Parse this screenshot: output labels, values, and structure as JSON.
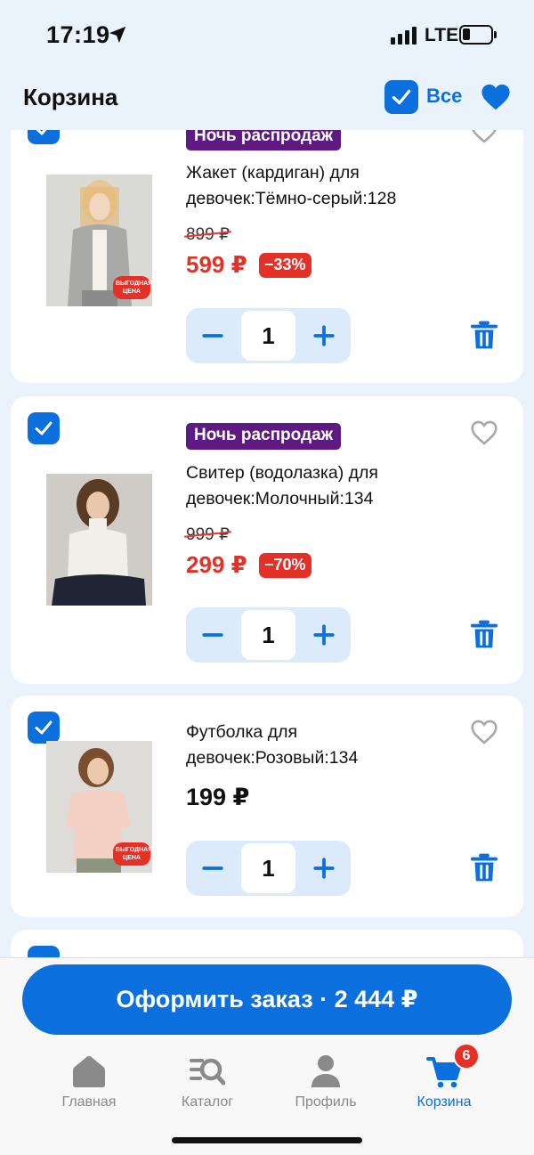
{
  "status_bar": {
    "time": "17:19",
    "network": "LTE"
  },
  "header": {
    "title": "Корзина",
    "select_all_label": "Все"
  },
  "cart_items": [
    {
      "promo": "Ночь распродаж",
      "title": "Жакет (кардиган) для девочек:Тёмно-серый:128",
      "old_price": "899 ₽",
      "price": "599 ₽",
      "discount": "−33%",
      "quantity": "1",
      "image_badge": "ВЫГОДНАЯ ЦЕНА"
    },
    {
      "promo": "Ночь распродаж",
      "title": "Свитер (водолазка) для девочек:Молочный:134",
      "old_price": "999 ₽",
      "price": "299 ₽",
      "discount": "−70%",
      "quantity": "1"
    },
    {
      "title": "Футболка для девочек:Розовый:134",
      "price": "199 ₽",
      "quantity": "1",
      "image_badge": "ВЫГОДНАЯ ЦЕНА"
    }
  ],
  "checkout": {
    "label": "Оформить заказ · 2 444 ₽"
  },
  "tabbar": {
    "home": "Главная",
    "catalog": "Каталог",
    "profile": "Профиль",
    "cart": "Корзина",
    "cart_count": "6"
  },
  "colors": {
    "accent": "#0b6fde",
    "sale": "#e53027",
    "promo_tag": "#5e1a82",
    "background": "#eaf2fb"
  }
}
